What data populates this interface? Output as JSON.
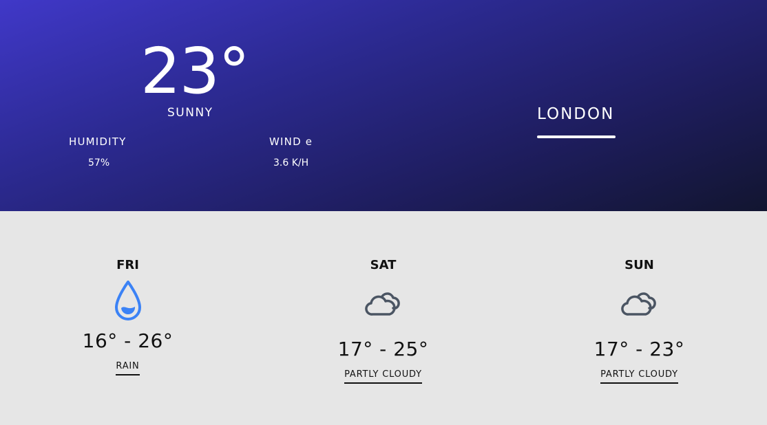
{
  "current": {
    "temperature": "23°",
    "condition": "SUNNY",
    "humidity_label": "HUMIDITY",
    "humidity_value": "57%",
    "wind_label": "WIND e",
    "wind_value": "3.6 K/H",
    "city": "LONDON"
  },
  "forecast": [
    {
      "day": "FRI",
      "icon": "raindrop-icon",
      "range": "16° - 26°",
      "description": "RAIN"
    },
    {
      "day": "SAT",
      "icon": "cloud-icon",
      "range": "17° - 25°",
      "description": "PARTLY CLOUDY"
    },
    {
      "day": "SUN",
      "icon": "cloud-icon",
      "range": "17° - 23°",
      "description": "PARTLY CLOUDY"
    }
  ],
  "colors": {
    "hero_gradient_start": "#4038c8",
    "hero_gradient_end": "#121530",
    "forecast_background": "#e6e6e6",
    "rain_icon": "#3b82f6",
    "cloud_icon": "#4b5563"
  }
}
